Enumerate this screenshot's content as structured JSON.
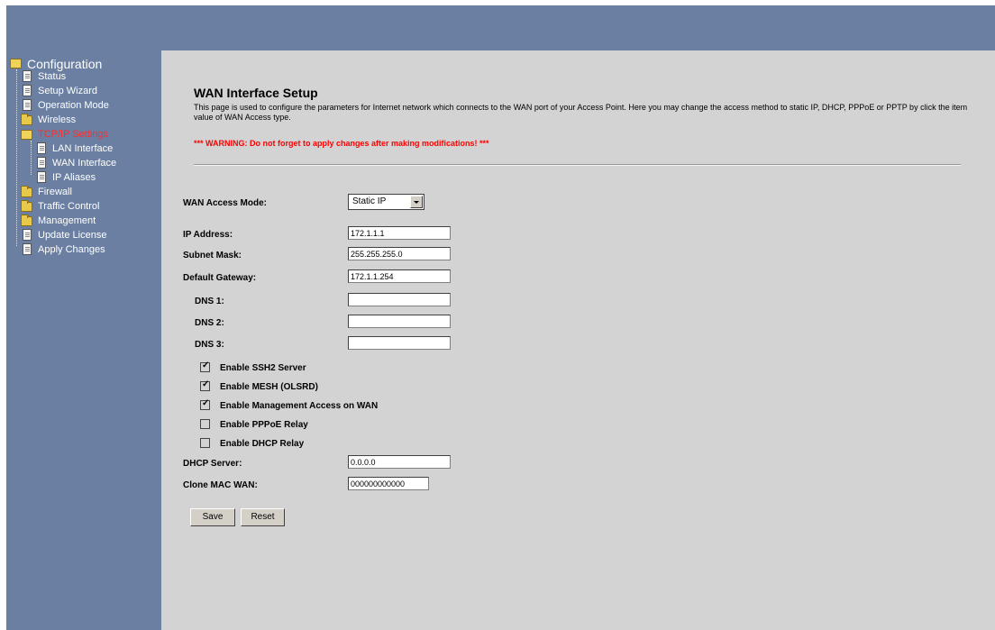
{
  "sidebar": {
    "root_label": "Configuration",
    "items": [
      {
        "label": "Status",
        "icon": "doc"
      },
      {
        "label": "Setup Wizard",
        "icon": "doc"
      },
      {
        "label": "Operation Mode",
        "icon": "doc"
      },
      {
        "label": "Wireless",
        "icon": "folder"
      },
      {
        "label": "TCP/IP Settings",
        "icon": "folder-open",
        "active": true
      },
      {
        "label": "LAN Interface",
        "icon": "doc"
      },
      {
        "label": "WAN Interface",
        "icon": "doc"
      },
      {
        "label": "IP Aliases",
        "icon": "doc"
      },
      {
        "label": "Firewall",
        "icon": "folder"
      },
      {
        "label": "Traffic Control",
        "icon": "folder"
      },
      {
        "label": "Management",
        "icon": "folder"
      },
      {
        "label": "Update License",
        "icon": "doc"
      },
      {
        "label": "Apply Changes",
        "icon": "doc"
      }
    ]
  },
  "page": {
    "title": "WAN Interface Setup",
    "description": "This page is used to configure the parameters for Internet network which connects to the WAN port of your Access Point. Here you may change the access method to static IP, DHCP, PPPoE or PPTP by click the item value of WAN Access type.",
    "warning": "*** WARNING: Do not forget to apply changes after making modifications! ***"
  },
  "form": {
    "access_mode_label": "WAN Access Mode:",
    "access_mode_value": "Static IP",
    "ip_label": "IP Address:",
    "ip_value": "172.1.1.1",
    "subnet_label": "Subnet Mask:",
    "subnet_value": "255.255.255.0",
    "gateway_label": "Default Gateway:",
    "gateway_value": "172.1.1.254",
    "dns1_label": "DNS 1:",
    "dns1_value": "",
    "dns2_label": "DNS 2:",
    "dns2_value": "",
    "dns3_label": "DNS 3:",
    "dns3_value": "",
    "ssh2_label": "Enable SSH2 Server",
    "ssh2_checked": true,
    "mesh_label": "Enable MESH (OLSRD)",
    "mesh_checked": true,
    "mgmt_label": "Enable Management Access on WAN",
    "mgmt_checked": true,
    "pppoe_label": "Enable PPPoE Relay",
    "pppoe_checked": false,
    "dhcp_relay_label": "Enable DHCP Relay",
    "dhcp_relay_checked": false,
    "dhcp_server_label": "DHCP Server:",
    "dhcp_server_value": "0.0.0.0",
    "clone_mac_label": "Clone MAC WAN:",
    "clone_mac_value": "000000000000",
    "save_label": "Save",
    "reset_label": "Reset"
  },
  "colors": {
    "frame": "#6a7fa1",
    "content_bg": "#d3d3d3",
    "active_nav": "#ff2d2d",
    "warning": "#ff0000"
  }
}
